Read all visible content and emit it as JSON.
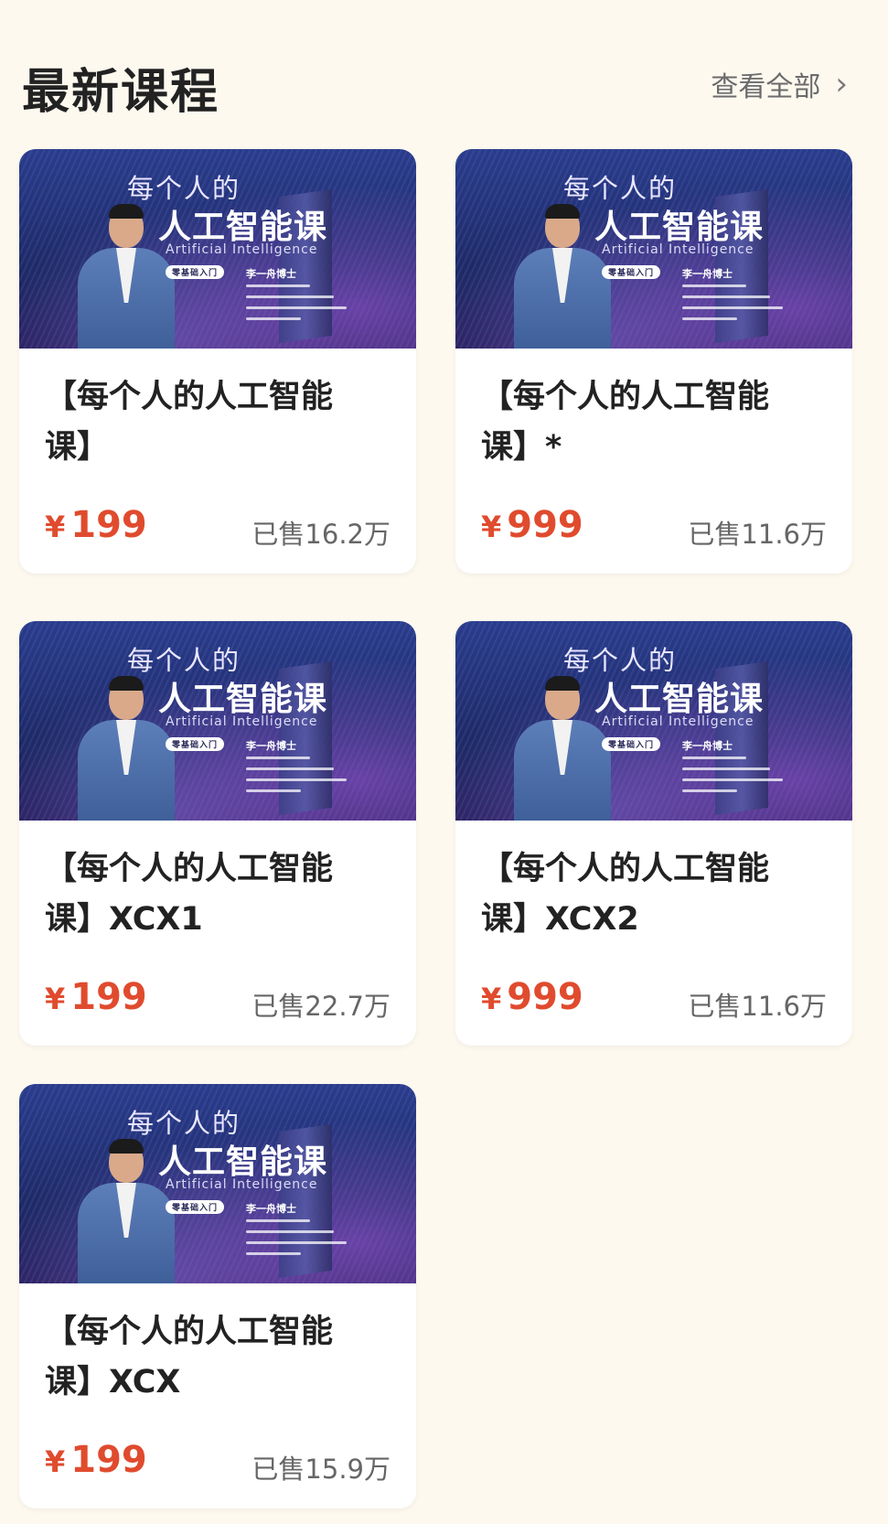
{
  "header": {
    "title": "最新课程",
    "view_all": "查看全部",
    "chevron_glyph": "›"
  },
  "banner": {
    "line1": "每个人的",
    "line2": "人工智能课",
    "english": "Artificial  Intelligence",
    "tag": "零基础入门",
    "name": "李一舟博士"
  },
  "courses": [
    {
      "title": "【每个人的人工智能课】",
      "currency": "¥",
      "price": "199",
      "sold": "已售16.2万"
    },
    {
      "title": "【每个人的人工智能课】*",
      "currency": "¥",
      "price": "999",
      "sold": "已售11.6万"
    },
    {
      "title": "【每个人的人工智能课】XCX1",
      "currency": "¥",
      "price": "199",
      "sold": "已售22.7万"
    },
    {
      "title": "【每个人的人工智能课】XCX2",
      "currency": "¥",
      "price": "999",
      "sold": "已售11.6万"
    },
    {
      "title": "【每个人的人工智能课】XCX",
      "currency": "¥",
      "price": "199",
      "sold": "已售15.9万"
    }
  ],
  "colors": {
    "background": "#fdf9ef",
    "price": "#e04b2e",
    "banner_dark": "#1e2a66"
  }
}
